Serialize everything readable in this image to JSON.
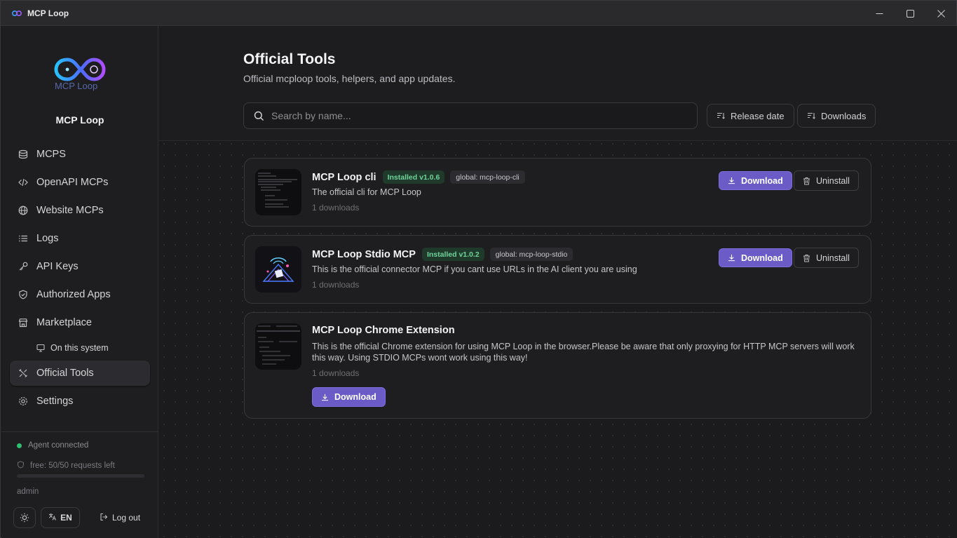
{
  "window": {
    "title": "MCP Loop"
  },
  "sidebar": {
    "brand_name": "MCP Loop",
    "logo_text": "MCP Loop",
    "items": [
      {
        "label": "MCPS",
        "icon": "database-icon"
      },
      {
        "label": "OpenAPI MCPs",
        "icon": "code-icon"
      },
      {
        "label": "Website MCPs",
        "icon": "globe-icon"
      },
      {
        "label": "Logs",
        "icon": "list-icon"
      },
      {
        "label": "API Keys",
        "icon": "key-icon"
      },
      {
        "label": "Authorized Apps",
        "icon": "shield-icon"
      },
      {
        "label": "Marketplace",
        "icon": "store-icon"
      },
      {
        "label": "On this system",
        "icon": "monitor-icon"
      },
      {
        "label": "Official Tools",
        "icon": "tools-icon",
        "active": true
      },
      {
        "label": "Settings",
        "icon": "gear-icon"
      }
    ],
    "status": "Agent connected",
    "quota": "free: 50/50 requests left",
    "user": "admin",
    "language": "EN",
    "logout": "Log out",
    "status_color": "#2fbf71"
  },
  "main": {
    "title": "Official Tools",
    "subtitle": "Official mcploop tools, helpers, and app updates.",
    "search_placeholder": "Search by name...",
    "sort_release": "Release date",
    "sort_downloads": "Downloads"
  },
  "tools": [
    {
      "name": "MCP Loop cli",
      "installed": "Installed v1.0.6",
      "global": "global: mcp-loop-cli",
      "description": "The official cli for MCP Loop",
      "downloads": "1 downloads",
      "download_label": "Download",
      "uninstall_label": "Uninstall"
    },
    {
      "name": "MCP Loop Stdio MCP",
      "installed": "Installed v1.0.2",
      "global": "global: mcp-loop-stdio",
      "description": "This is the official connector MCP if you cant use URLs in the AI client you are using",
      "downloads": "1 downloads",
      "download_label": "Download",
      "uninstall_label": "Uninstall"
    },
    {
      "name": "MCP Loop Chrome Extension",
      "description": "This is the official Chrome extension for using MCP Loop in the browser.Please be aware that only proxying for HTTP MCP servers will work this way. Using STDIO MCPs wont work using this way!",
      "downloads": "1 downloads",
      "download_label": "Download"
    }
  ],
  "colors": {
    "accent": "#6b5bc7",
    "installed_badge": "#6fd39a"
  }
}
